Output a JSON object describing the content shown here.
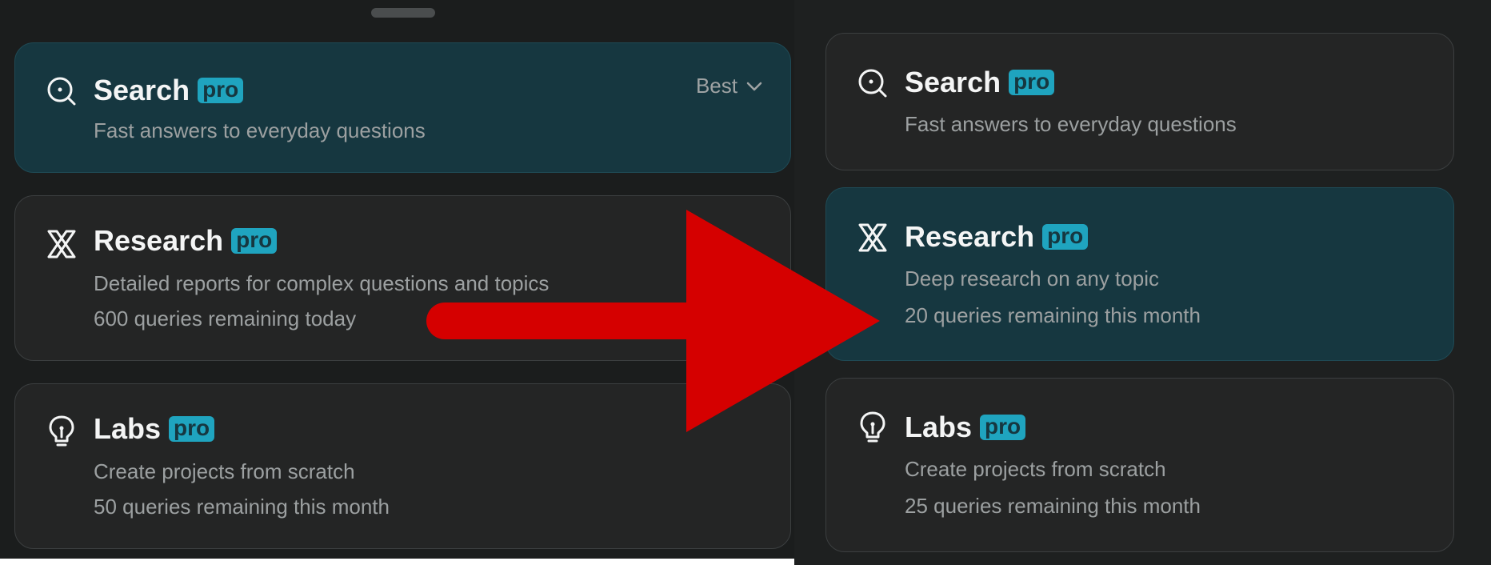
{
  "left_panel": {
    "cards": [
      {
        "title": "Search",
        "badge": "pro",
        "lines": [
          "Fast answers to everyday questions"
        ],
        "dropdown_label": "Best",
        "icon": "search-icon",
        "selected": true
      },
      {
        "title": "Research",
        "badge": "pro",
        "lines": [
          "Detailed reports for complex questions and topics",
          "600 queries remaining today"
        ],
        "icon": "atom-icon",
        "selected": false
      },
      {
        "title": "Labs",
        "badge": "pro",
        "lines": [
          "Create projects from scratch",
          "50 queries remaining this month"
        ],
        "icon": "lightbulb-icon",
        "selected": false
      }
    ]
  },
  "right_panel": {
    "cards": [
      {
        "title": "Search",
        "badge": "pro",
        "lines": [
          "Fast answers to everyday questions"
        ],
        "icon": "search-icon",
        "selected": false
      },
      {
        "title": "Research",
        "badge": "pro",
        "lines": [
          "Deep research on any topic",
          "20 queries remaining this month"
        ],
        "icon": "atom-icon",
        "selected": true
      },
      {
        "title": "Labs",
        "badge": "pro",
        "lines": [
          "Create projects from scratch",
          "25 queries remaining this month"
        ],
        "icon": "lightbulb-icon",
        "selected": false
      }
    ]
  },
  "colors": {
    "selected_card": "#163740",
    "card": "#242525",
    "badge": "#1fa4bf",
    "arrow": "#d50000"
  }
}
